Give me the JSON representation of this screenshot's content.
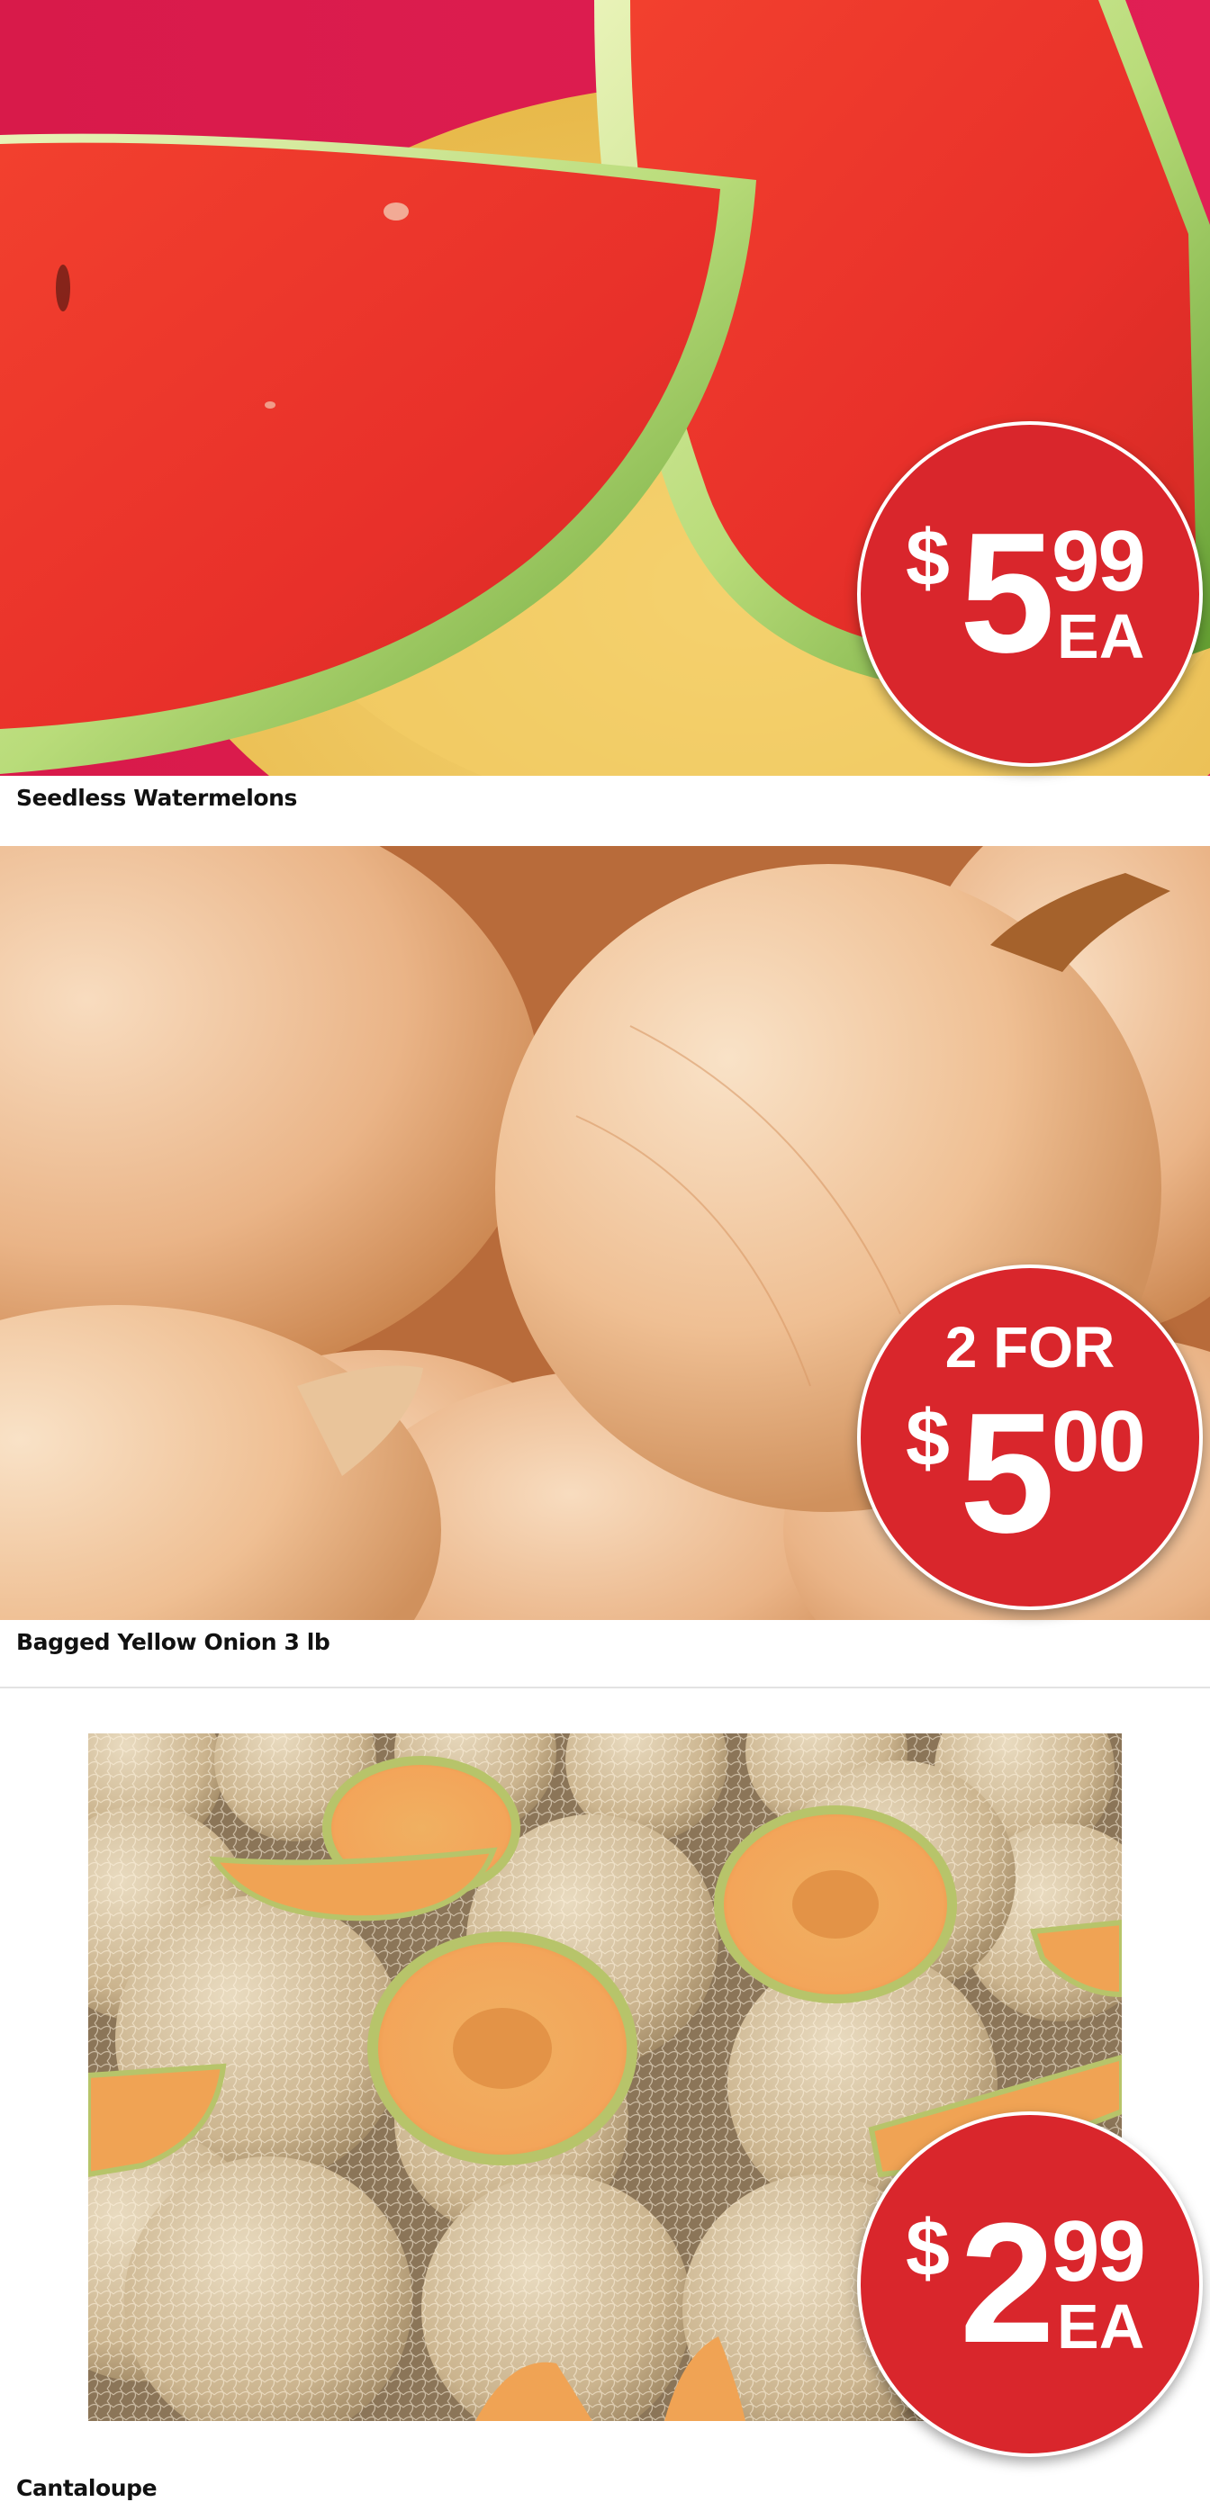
{
  "products": [
    {
      "name": "Seedless Watermelons",
      "image_subject": "watermelon-slices",
      "price": {
        "currency": "$",
        "dollars": "5",
        "cents": "99",
        "unit": "EA"
      }
    },
    {
      "name": "Bagged Yellow Onion 3 lb",
      "image_subject": "yellow-onions",
      "price": {
        "prefix": "2 FOR",
        "currency": "$",
        "dollars": "5",
        "cents": "00"
      }
    },
    {
      "name": "Cantaloupe",
      "image_subject": "cantaloupes",
      "price": {
        "currency": "$",
        "dollars": "2",
        "cents": "99",
        "unit": "EA"
      }
    }
  ],
  "colors": {
    "badge_red": "#d9262c",
    "badge_text": "#ffffff",
    "name_text": "#111111",
    "divider": "#e3e3e3"
  }
}
